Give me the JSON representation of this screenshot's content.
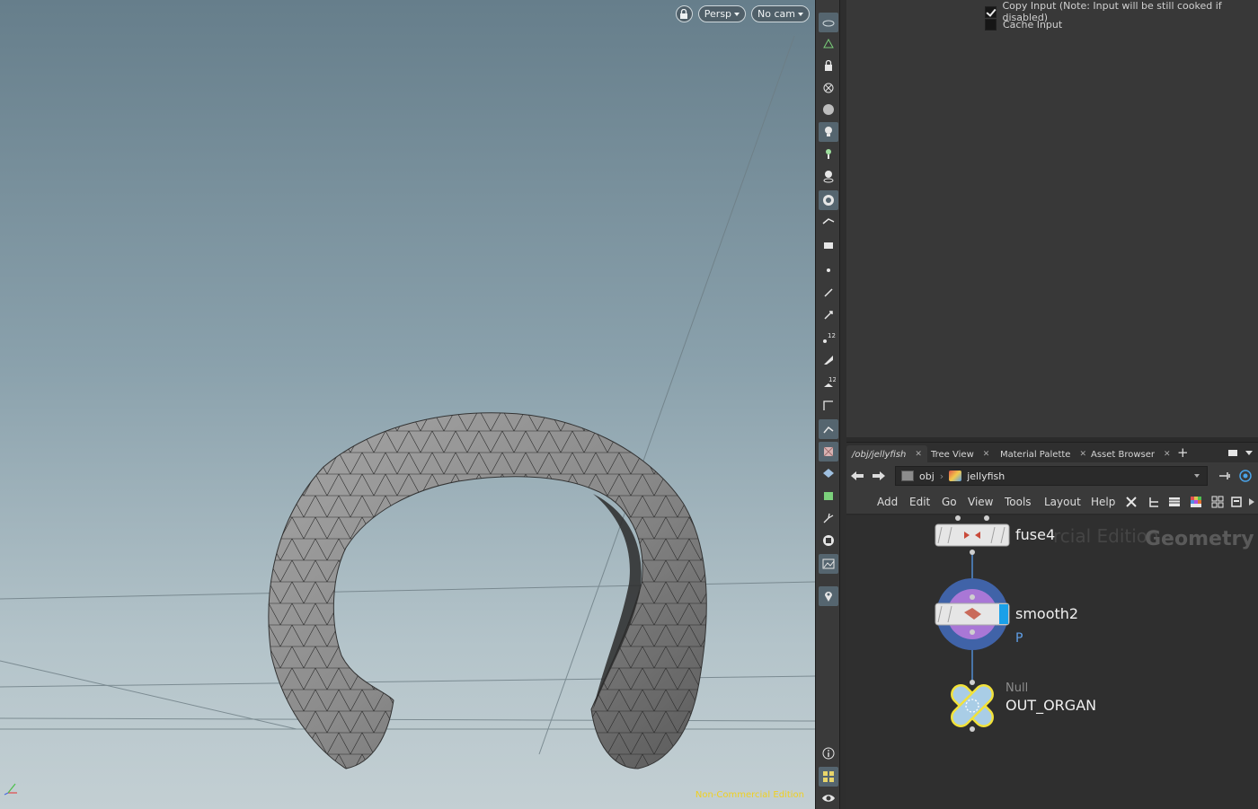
{
  "viewport": {
    "persp_label": "Persp",
    "cam_label": "No cam",
    "edition_note": "Non-Commercial Edition",
    "axis_x": "x",
    "axis_y": "y",
    "axis_z": "z"
  },
  "toolbar": {
    "icons": [
      "ghost-icon",
      "display-options-icon",
      "lock-icon",
      "snap-icon",
      "shading-icon",
      "light-icon",
      "headlight-icon",
      "camera-icon",
      "wire-ghost-icon",
      "point-display-icon",
      "normal-display-icon",
      "point-number-icon",
      "brush-icon",
      "vertex-number-icon",
      "curve-icon",
      "transform-icon",
      "uv-icon",
      "geometry-icon",
      "bake-icon",
      "link-icon",
      "reference-icon",
      "background-image-icon",
      "pin-icon",
      "info-icon",
      "layout-icon",
      "visibility-icon"
    ]
  },
  "params": {
    "copy_input_label": "Copy Input (Note: Input will be still cooked if disabled)",
    "copy_input_checked": true,
    "cache_input_label": "Cache Input",
    "cache_input_checked": false
  },
  "tabs": [
    {
      "label": "/obj/jellyfish"
    },
    {
      "label": "Tree View"
    },
    {
      "label": "Material Palette"
    },
    {
      "label": "Asset Browser"
    }
  ],
  "path": {
    "root": "obj",
    "current": "jellyfish"
  },
  "menu": [
    "Add",
    "Edit",
    "Go",
    "View",
    "Tools",
    "Layout",
    "Help"
  ],
  "network": {
    "watermark_1": "rcial Edition",
    "watermark_2": "Geometry",
    "nodes": [
      {
        "name": "fuse4"
      },
      {
        "name": "smooth2",
        "sub": "P"
      },
      {
        "name": "OUT_ORGAN",
        "type": "Null"
      }
    ]
  },
  "colors": {
    "viewport_sky_top": "#667e8b",
    "viewport_sky_bottom": "#c3cfd3",
    "edition_yellow": "#f0d020",
    "node_blue": "#5f9fe8",
    "null_yellow": "#f2e23a"
  }
}
